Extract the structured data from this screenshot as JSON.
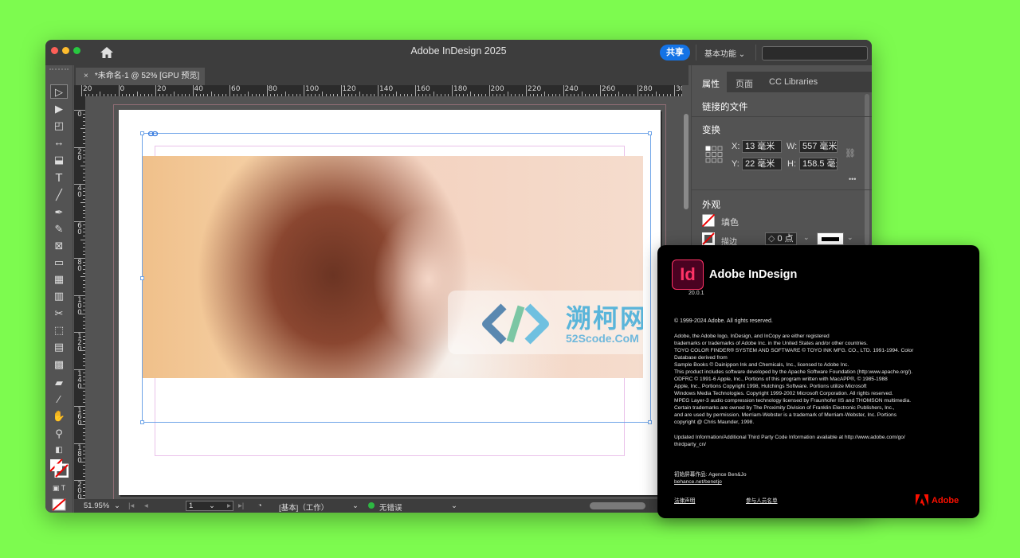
{
  "window": {
    "title": "Adobe InDesign 2025",
    "share_label": "共享",
    "workspace_label": "基本功能",
    "search_placeholder": ""
  },
  "document": {
    "tab_label": "*未命名-1 @ 52% [GPU 预览]",
    "close_glyph": "×"
  },
  "rulers": {
    "horizontal": [
      "20",
      "0",
      "20",
      "40",
      "60",
      "80",
      "100",
      "120",
      "140",
      "160",
      "180",
      "200",
      "220",
      "240",
      "260",
      "280",
      "300"
    ],
    "vertical": [
      "0",
      "20",
      "40",
      "60",
      "80",
      "100",
      "120",
      "140",
      "160",
      "180",
      "200"
    ]
  },
  "watermark": {
    "title": "溯柯网",
    "subtitle": "52Scode.CoM"
  },
  "statusbar": {
    "zoom": "51.95%",
    "page": "1",
    "master": "[基本]（工作）",
    "errors": "无错误"
  },
  "panel": {
    "tabs": [
      "属性",
      "页面",
      "CC Libraries"
    ],
    "linked_files": "链接的文件",
    "transform": "变换",
    "x_label": "X:",
    "x_value": "13 毫米",
    "y_label": "Y:",
    "y_value": "22 毫米",
    "w_label": "W:",
    "w_value": "557 毫米",
    "h_label": "H:",
    "h_value": "158.5 毫米",
    "more": "•••",
    "appearance": "外观",
    "fill": "填色",
    "stroke": "描边",
    "stroke_weight": "0 点"
  },
  "about": {
    "logo_text": "Id",
    "product": "Adobe InDesign",
    "version": "20.0.1",
    "copyright": "© 1999-2024 Adobe. All rights reserved.",
    "legal": [
      "Adobe, the Adobe logo, InDesign, and InCopy are either registered",
      "trademarks or trademarks of Adobe Inc. in the United States and/or other countries.",
      "TOYO COLOR FINDER® SYSTEM AND SOFTWARE © TOYO INK MFG. CO., LTD. 1991-1994. Color",
      "Database derived from",
      "Sample Books © Dainippon Ink and Chemicals, Inc., licensed to Adobe Inc.",
      "This product includes software developed by the Apache Software Foundation (http:www.apache.org/).",
      "ODFRC © 1991-6 Apple, Inc., Portions of this program written with MacAPP®, © 1985-1988",
      "Apple, Inc., Portions Copyright 1998, Hutchings Software. Portions utilize Microsoft",
      "Windows Media Technologies. Copyright 1999-2002 Microsoft Corporation. All rights reserved.",
      "MPEG Layer-3 audio compression technology licensed by Fraunhofer IIS and THOMSON multimedia.",
      "Certain trademarks are owned by The Proximity Division of Franklin Electronic Publishers, Inc.,",
      "and are used by permission. Merriam-Webster is a trademark of Merriam-Webster, Inc. Portions",
      "copyright @ Chris Maunder, 1998."
    ],
    "updated_line1": "Updated Information/Additional Third Party Code Information available at http://www.adobe.com/go/",
    "updated_line2": "thirdparty_cn/",
    "credit_label": "初始屏幕作品: Agence Ben&Jo",
    "credit_link": "behance.net/benetjo",
    "legal_link": "法律声明",
    "contributors_link": "参与人员名单",
    "brand": "Adobe"
  }
}
